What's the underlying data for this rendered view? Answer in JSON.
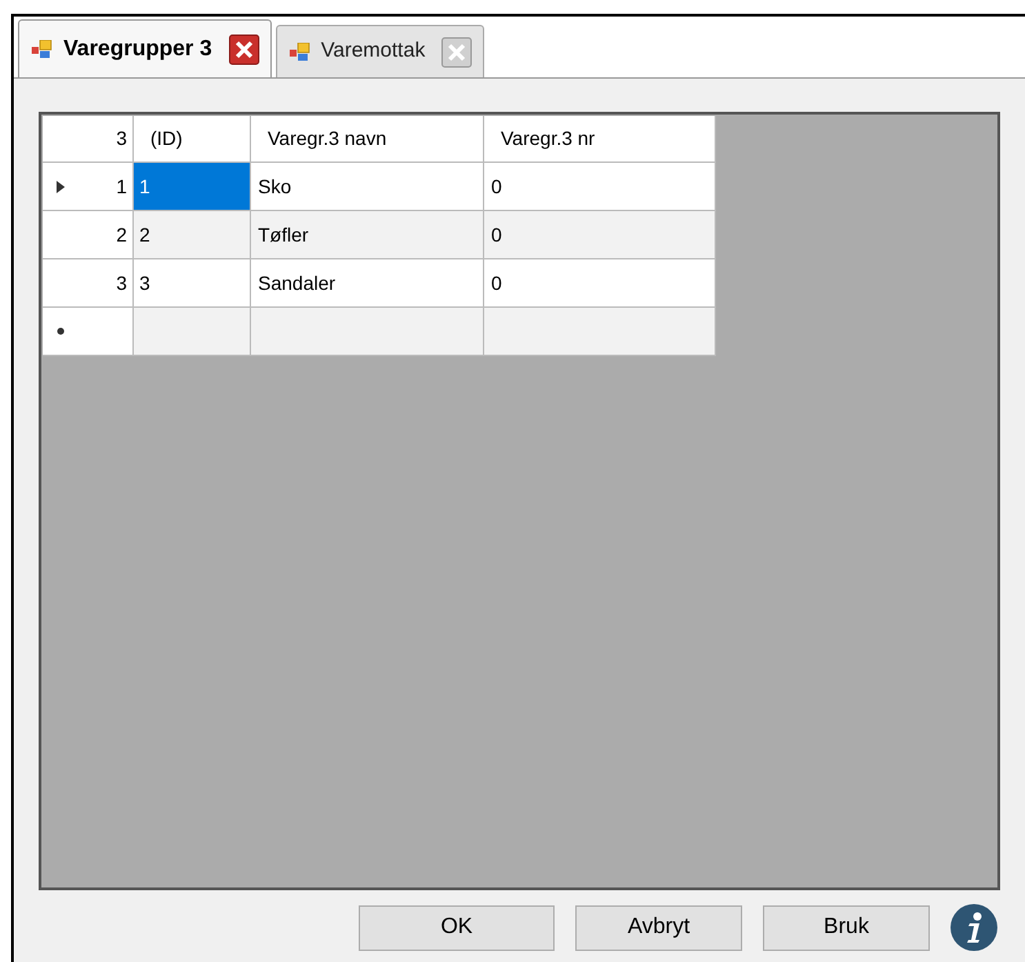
{
  "tabs": [
    {
      "label": "Varegrupper 3",
      "selected": true
    },
    {
      "label": "Varemottak",
      "selected": false
    }
  ],
  "table": {
    "corner": "3",
    "columns": [
      "(ID)",
      "Varegr.3 navn",
      "Varegr.3 nr"
    ],
    "rows": [
      {
        "number": "1",
        "kind": "current",
        "selected": true,
        "cells": [
          "1",
          "Sko",
          "0"
        ]
      },
      {
        "number": "2",
        "kind": "plain",
        "selected": false,
        "cells": [
          "2",
          "Tøfler",
          "0"
        ]
      },
      {
        "number": "3",
        "kind": "plain",
        "selected": false,
        "cells": [
          "3",
          "Sandaler",
          "0"
        ]
      },
      {
        "number": "",
        "kind": "new",
        "selected": false,
        "cells": [
          "",
          "",
          ""
        ]
      }
    ]
  },
  "buttons": [
    "OK",
    "Avbryt",
    "Bruk"
  ]
}
